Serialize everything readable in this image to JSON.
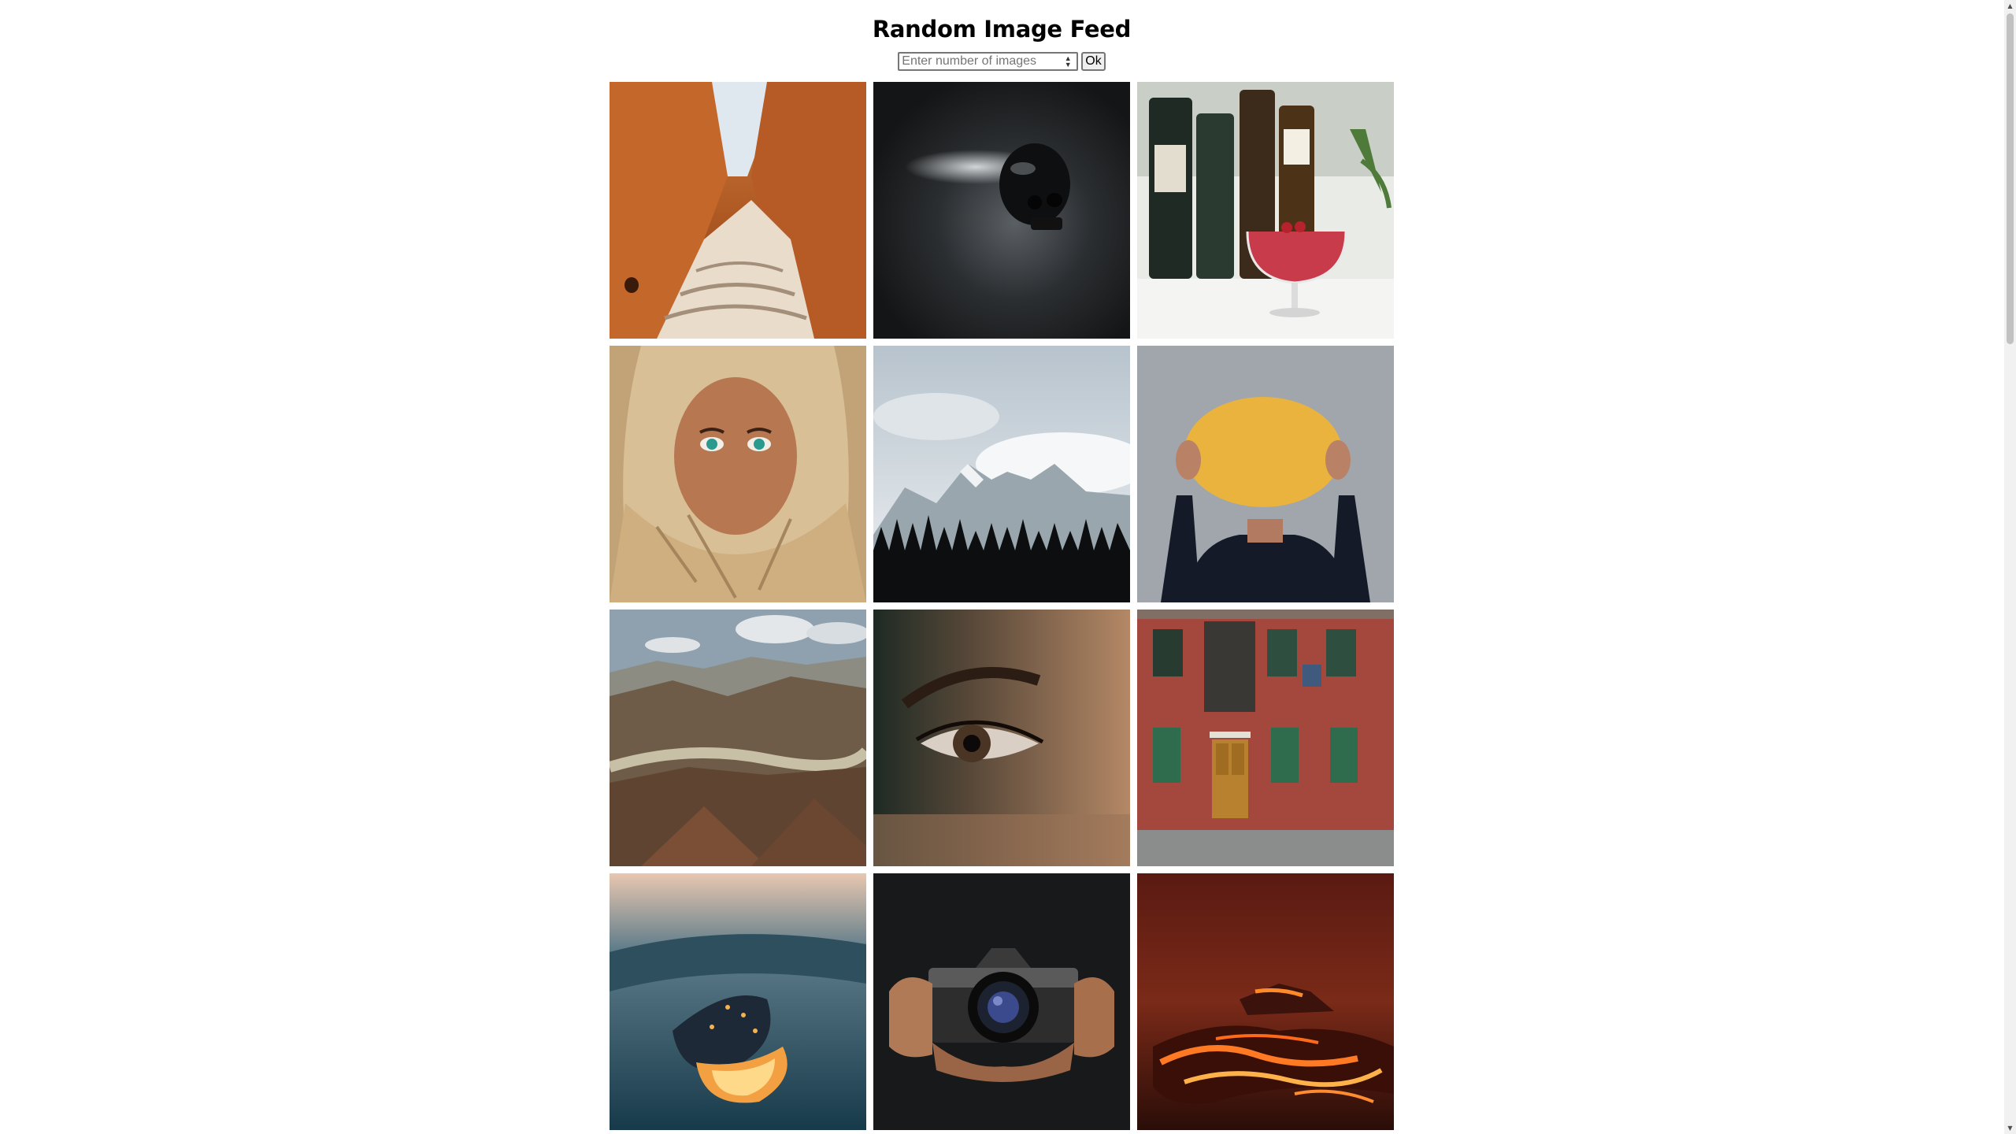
{
  "header": {
    "title": "Random Image Feed"
  },
  "controls": {
    "input_placeholder": "Enter number of images",
    "input_value": "",
    "ok_label": "Ok"
  },
  "feed": {
    "images": [
      {
        "name": "canyon-hoodoos-image"
      },
      {
        "name": "black-skull-image"
      },
      {
        "name": "cocktail-bottles-image"
      },
      {
        "name": "woman-headscarf-image"
      },
      {
        "name": "snowy-mountains-forest-image"
      },
      {
        "name": "yellow-disc-person-image"
      },
      {
        "name": "grand-canyon-landscape-image"
      },
      {
        "name": "eye-closeup-image"
      },
      {
        "name": "red-building-facade-image"
      },
      {
        "name": "burning-object-image"
      },
      {
        "name": "pentax-camera-hands-image"
      },
      {
        "name": "lava-flow-image"
      }
    ]
  },
  "icons": {
    "spinner": "number-spinner-icon",
    "scroll_up": "scroll-up-arrow-icon",
    "scroll_down": "scroll-down-arrow-icon"
  }
}
